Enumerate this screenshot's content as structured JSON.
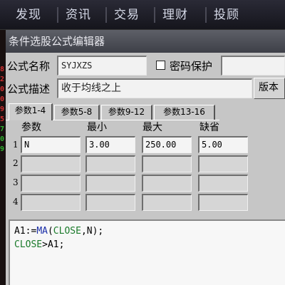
{
  "menu": {
    "items": [
      "发现",
      "资讯",
      "交易",
      "理财",
      "投顾"
    ]
  },
  "left_strip": {
    "numbers": [
      {
        "text": "8",
        "color": "#d03030"
      },
      {
        "text": "2",
        "color": "#d03030"
      },
      {
        "text": "0",
        "color": "#d03030"
      },
      {
        "text": "0",
        "color": "#d03030"
      },
      {
        "text": "9",
        "color": "#d03030"
      },
      {
        "text": "5",
        "color": "#d03030"
      },
      {
        "text": "7",
        "color": "#30b030"
      },
      {
        "text": "0",
        "color": "#30b030"
      },
      {
        "text": "9",
        "color": "#30b030"
      }
    ]
  },
  "dialog": {
    "title": "条件选股公式编辑器",
    "name_label": "公式名称",
    "name_value": "SYJXZS",
    "password_label": "密码保护",
    "password_checked": false,
    "desc_label": "公式描述",
    "desc_value": "收于均线之上",
    "version_label": "版本",
    "tabs": [
      "参数1-4",
      "参数5-8",
      "参数9-12",
      "参数13-16"
    ],
    "active_tab": 0,
    "columns": [
      "参数",
      "最小",
      "最大",
      "缺省"
    ],
    "params": [
      {
        "row": "1",
        "name": "N",
        "min": "3.00",
        "max": "250.00",
        "default": "5.00"
      },
      {
        "row": "2",
        "name": "",
        "min": "",
        "max": "",
        "default": ""
      },
      {
        "row": "3",
        "name": "",
        "min": "",
        "max": "",
        "default": ""
      },
      {
        "row": "4",
        "name": "",
        "min": "",
        "max": "",
        "default": ""
      }
    ]
  },
  "editor": {
    "line1": {
      "var": "A1",
      "assign": ":=",
      "fn": "MA",
      "open": "(",
      "kw": "CLOSE",
      "args": ",N);"
    },
    "line2": {
      "kw": "CLOSE",
      "rest": ">A1;"
    }
  },
  "colors": {
    "menubar": "#1c1c24",
    "dialog_bg": "#c6c6c6",
    "titlebar": "#4e5058",
    "function_blue": "#1a2ea8",
    "keyword_green": "#1a7a2a"
  }
}
